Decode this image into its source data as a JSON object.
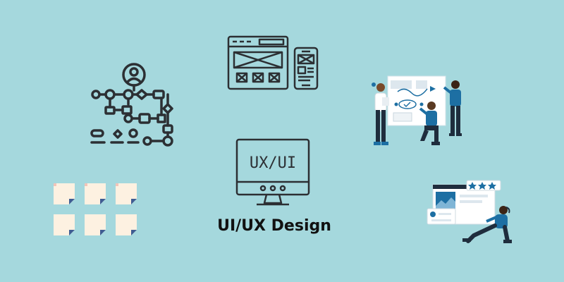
{
  "title": "UI/UX Design",
  "monitor_label": "UX/UI",
  "colors": {
    "background": "#a5d8dd",
    "outline": "#2c2f33",
    "accent_blue": "#1d6fa3",
    "navy": "#1f2d3d",
    "note": "#fdf1e1",
    "note_fold": "#3f5d92"
  },
  "icons": [
    "user-flow-icon",
    "wireframe-icon",
    "team-planning-illustration",
    "monitor-icon",
    "sticky-notes-icon",
    "rating-illustration"
  ]
}
